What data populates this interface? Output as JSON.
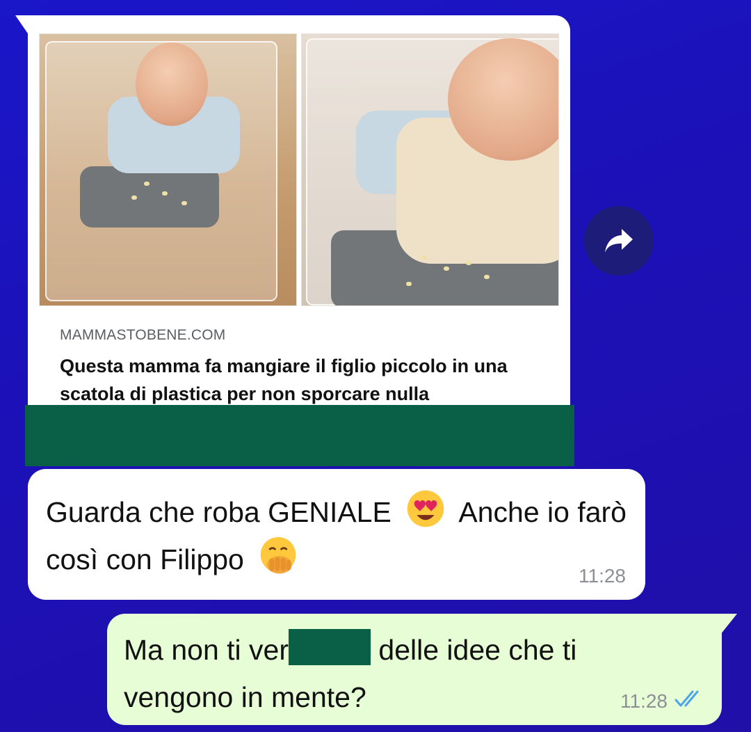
{
  "link_preview": {
    "site": "MAMMASTOBENE.COM",
    "title": "Questa mamma fa mangiare il figlio piccolo in una scatola di plastica per non sporcare nulla",
    "image_description_icon": "baby-eating-photo"
  },
  "forward_button": {
    "icon": "forward-arrow-icon"
  },
  "messages": {
    "incoming": {
      "text_part1": "Guarda che roba GENIALE",
      "emoji1": "heart-eyes-emoji",
      "text_part2": "Anche io farò così con Filippo",
      "emoji2": "hand-over-mouth-emoji",
      "time": "11:28"
    },
    "outgoing": {
      "text_before_redaction": "Ma non ti ver",
      "text_after_redaction": "delle idee che ti vengono in mente?",
      "time": "11:28",
      "status_icon": "double-check-read-icon"
    }
  },
  "colors": {
    "background": "#1c11b8",
    "incoming_bubble": "#ffffff",
    "outgoing_bubble": "#e6fdd6",
    "redaction": "#096047",
    "read_ticks": "#4aa6e8"
  }
}
